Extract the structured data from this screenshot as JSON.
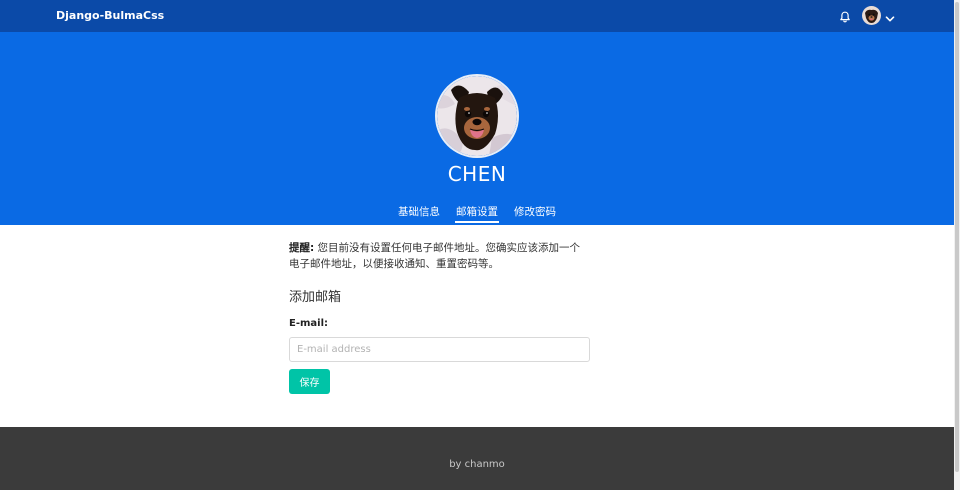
{
  "navbar": {
    "brand": "Django-BulmaCss",
    "icons": [
      "bell-icon",
      "avatar",
      "chevron-down-icon"
    ]
  },
  "profile": {
    "name": "CHEN"
  },
  "tabs": [
    {
      "label": "基础信息",
      "active": false
    },
    {
      "label": "邮箱设置",
      "active": true
    },
    {
      "label": "修改密码",
      "active": false
    }
  ],
  "notice": {
    "title": "提醒:",
    "text": " 您目前没有设置任何电子邮件地址。您确实应该添加一个电子邮件地址，以便接收通知、重置密码等。"
  },
  "email_form": {
    "section_title": "添加邮箱",
    "label": "E-mail:",
    "value": "",
    "placeholder": "E-mail address",
    "save_label": "保存"
  },
  "footer": {
    "text": "by chanmo"
  },
  "colors": {
    "navbar": "#0b4aa8",
    "hero": "#0a6ae4",
    "primary_button": "#00c4a7",
    "footer": "#3b3b3b"
  }
}
